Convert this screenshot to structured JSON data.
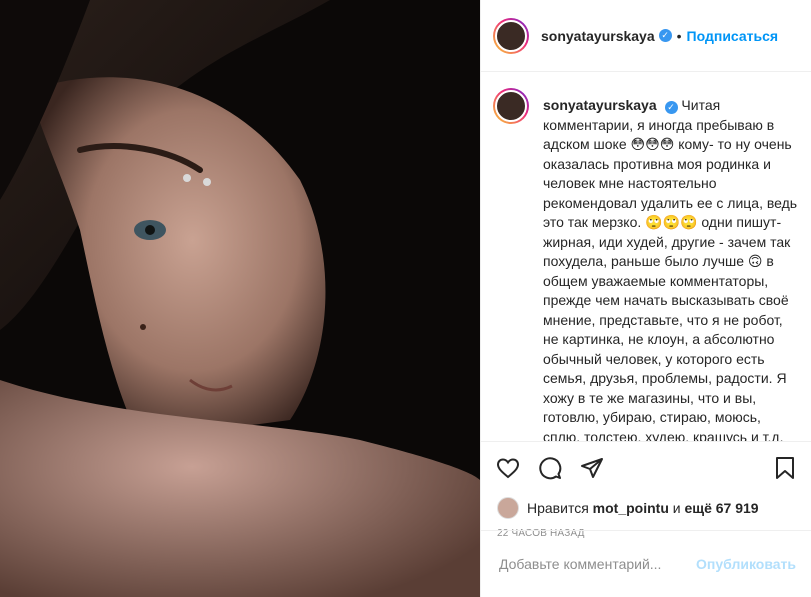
{
  "header": {
    "username": "sonyatayurskaya",
    "dot": "•",
    "follow_label": "Подписаться"
  },
  "caption": {
    "username": "sonyatayurskaya",
    "text": "Читая комментарии, я иногда пребываю в адском шоке 😳😳😳 кому- то ну очень оказалась противна моя родинка и человек мне настоятельно рекомендовал удалить ее с лица, ведь это так мерзко. 🙄🙄🙄 одни пишут-жирная, иди худей, другие - зачем так похудела, раньше было лучше 🙃 в общем уважаемые комментаторы, прежде чем начать высказывать своё мнение, представьте, что я не робот, не картинка, не клоун, а абсолютно обычный человек, у которого есть семья, друзья, проблемы, радости. Я хожу в те же магазины, что и вы, готовлю, убираю, стираю, моюсь, сплю, толстею, худею, крашусь и т.д."
  },
  "likes": {
    "prefix": "Нравится",
    "user": "mot_pointu",
    "middle": "и",
    "count": "ещё 67 919"
  },
  "timestamp": "22 ЧАСОВ НАЗАД",
  "comment_input": {
    "placeholder": "Добавьте комментарий...",
    "post_label": "Опубликовать"
  },
  "icons": {
    "like": "heart-icon",
    "comment": "comment-icon",
    "share": "share-icon",
    "save": "bookmark-icon",
    "verified": "verified-badge-icon"
  },
  "colors": {
    "accent": "#0095f6",
    "verified": "#3897f0",
    "post_disabled": "#b2dffc"
  }
}
